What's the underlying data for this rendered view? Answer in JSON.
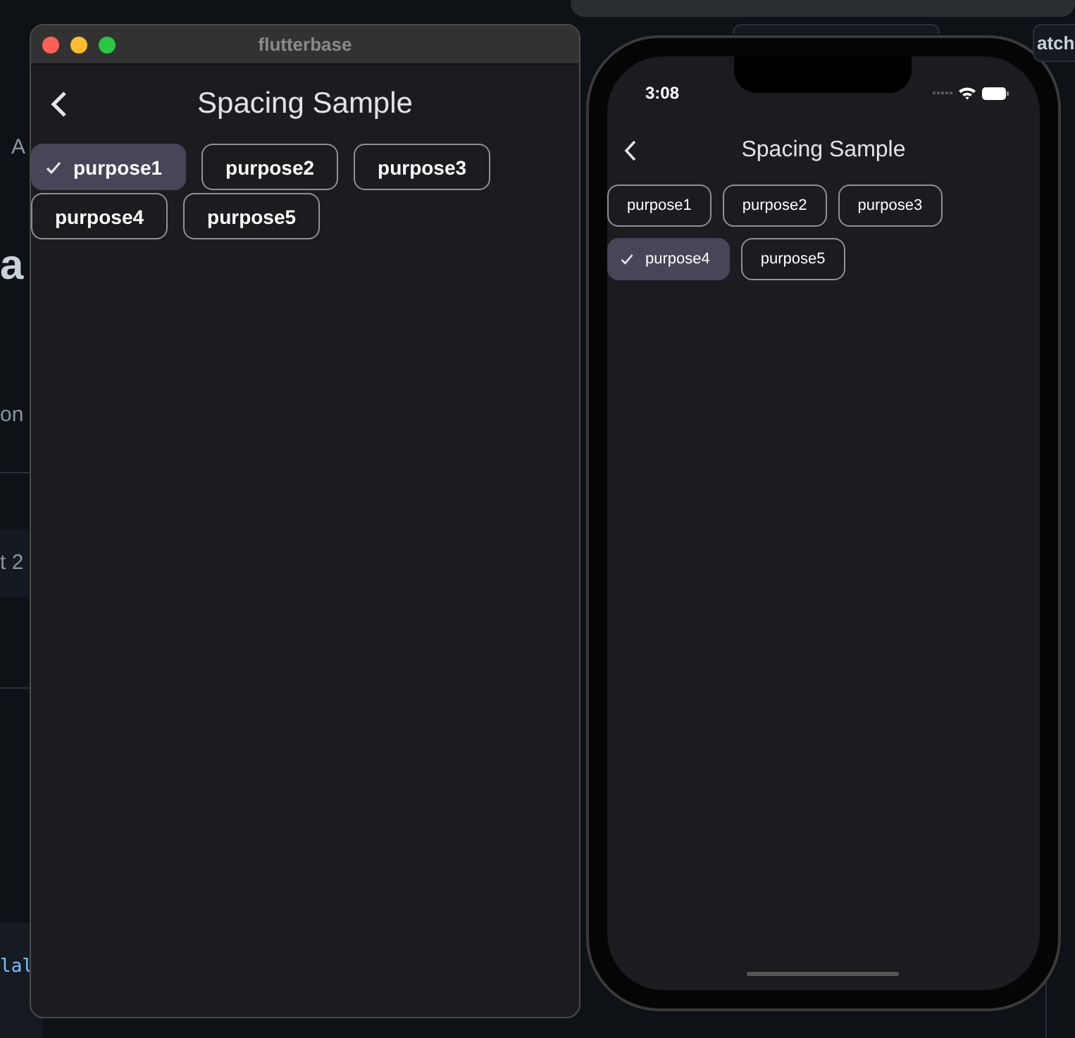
{
  "background_fragments": [
    {
      "text": "A",
      "kind": "label"
    },
    {
      "text": "a",
      "kind": "heading"
    },
    {
      "text": "on",
      "kind": "label"
    },
    {
      "text": "t 2",
      "kind": "label"
    },
    {
      "text": "lal",
      "kind": "code"
    },
    {
      "text": "atch",
      "kind": "button"
    }
  ],
  "desktop_window": {
    "title": "flutterbase",
    "app_bar": {
      "title": "Spacing Sample"
    },
    "chips": [
      {
        "label": "purpose1",
        "selected": true
      },
      {
        "label": "purpose2",
        "selected": false
      },
      {
        "label": "purpose3",
        "selected": false
      },
      {
        "label": "purpose4",
        "selected": false
      },
      {
        "label": "purpose5",
        "selected": false
      }
    ]
  },
  "phone": {
    "status_bar": {
      "time": "3:08"
    },
    "app_bar": {
      "title": "Spacing Sample"
    },
    "chips": [
      {
        "label": "purpose1",
        "selected": false
      },
      {
        "label": "purpose2",
        "selected": false
      },
      {
        "label": "purpose3",
        "selected": false
      },
      {
        "label": "purpose4",
        "selected": true
      },
      {
        "label": "purpose5",
        "selected": false
      }
    ]
  }
}
